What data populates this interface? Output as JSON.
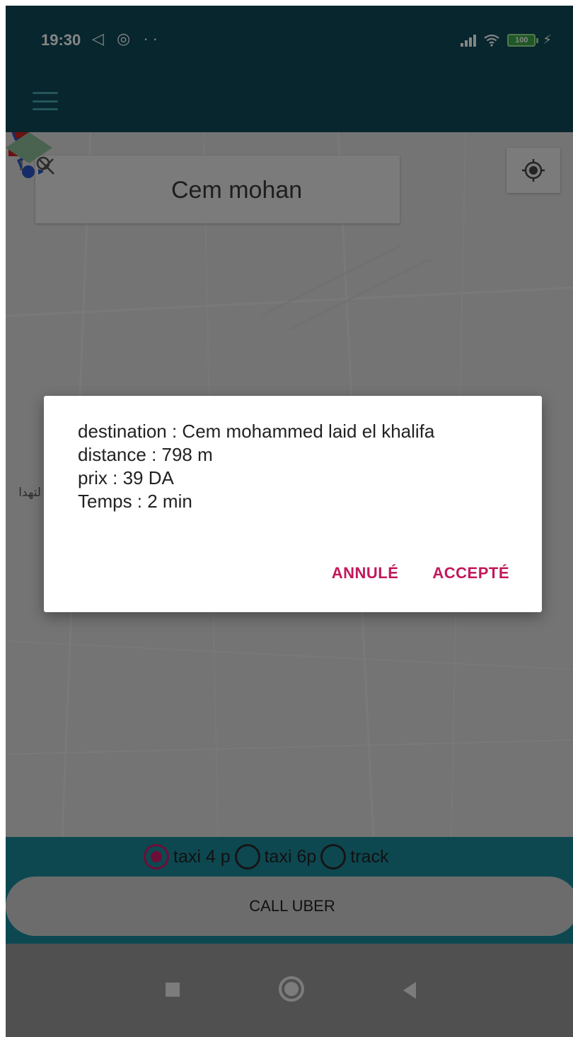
{
  "status_bar": {
    "time": "19:30",
    "left_icons": [
      "navigation-icon",
      "sync-icon",
      "more-dots-icon"
    ],
    "left_icons_text": "◁ ◎ ··",
    "battery": "100"
  },
  "search": {
    "query": "Cem mohan"
  },
  "map": {
    "label_text": "لتهدا"
  },
  "dialog": {
    "destination_line": "destination : Cem mohammed laid el khalifa",
    "distance_line": "distance : 798 m",
    "price_line": "prix : 39 DA",
    "time_line": "Temps : 2 min",
    "cancel_label": "ANNULÉ",
    "accept_label": "ACCEPTÉ"
  },
  "vehicle_options": [
    {
      "label": "taxi 4 p",
      "checked": true
    },
    {
      "label": "taxi 6p",
      "checked": false
    },
    {
      "label": "track",
      "checked": false
    }
  ],
  "call_button": {
    "label": "CALL UBER"
  },
  "colors": {
    "app_bar": "#0e4a56",
    "bottom_panel": "#1a8a9c",
    "accent": "#c2185b",
    "radio_checked": "#d01c6a"
  }
}
